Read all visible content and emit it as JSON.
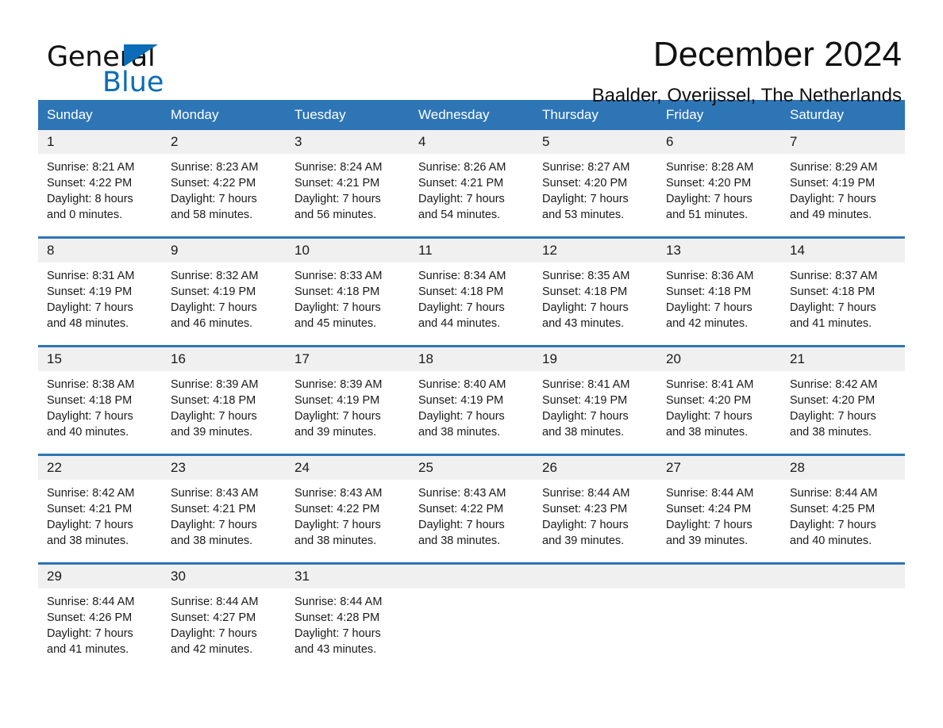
{
  "brand": {
    "name_part1": "General",
    "name_part2": "Blue"
  },
  "header": {
    "title": "December 2024",
    "location": "Baalder, Overijssel, The Netherlands"
  },
  "colors": {
    "header_blue": "#2e75b6",
    "logo_blue": "#0b6cb7",
    "daynum_bg": "#f0f0f0"
  },
  "weekdays": [
    "Sunday",
    "Monday",
    "Tuesday",
    "Wednesday",
    "Thursday",
    "Friday",
    "Saturday"
  ],
  "weeks": [
    [
      {
        "day": "1",
        "sunrise": "Sunrise: 8:21 AM",
        "sunset": "Sunset: 4:22 PM",
        "daylight1": "Daylight: 8 hours",
        "daylight2": "and 0 minutes."
      },
      {
        "day": "2",
        "sunrise": "Sunrise: 8:23 AM",
        "sunset": "Sunset: 4:22 PM",
        "daylight1": "Daylight: 7 hours",
        "daylight2": "and 58 minutes."
      },
      {
        "day": "3",
        "sunrise": "Sunrise: 8:24 AM",
        "sunset": "Sunset: 4:21 PM",
        "daylight1": "Daylight: 7 hours",
        "daylight2": "and 56 minutes."
      },
      {
        "day": "4",
        "sunrise": "Sunrise: 8:26 AM",
        "sunset": "Sunset: 4:21 PM",
        "daylight1": "Daylight: 7 hours",
        "daylight2": "and 54 minutes."
      },
      {
        "day": "5",
        "sunrise": "Sunrise: 8:27 AM",
        "sunset": "Sunset: 4:20 PM",
        "daylight1": "Daylight: 7 hours",
        "daylight2": "and 53 minutes."
      },
      {
        "day": "6",
        "sunrise": "Sunrise: 8:28 AM",
        "sunset": "Sunset: 4:20 PM",
        "daylight1": "Daylight: 7 hours",
        "daylight2": "and 51 minutes."
      },
      {
        "day": "7",
        "sunrise": "Sunrise: 8:29 AM",
        "sunset": "Sunset: 4:19 PM",
        "daylight1": "Daylight: 7 hours",
        "daylight2": "and 49 minutes."
      }
    ],
    [
      {
        "day": "8",
        "sunrise": "Sunrise: 8:31 AM",
        "sunset": "Sunset: 4:19 PM",
        "daylight1": "Daylight: 7 hours",
        "daylight2": "and 48 minutes."
      },
      {
        "day": "9",
        "sunrise": "Sunrise: 8:32 AM",
        "sunset": "Sunset: 4:19 PM",
        "daylight1": "Daylight: 7 hours",
        "daylight2": "and 46 minutes."
      },
      {
        "day": "10",
        "sunrise": "Sunrise: 8:33 AM",
        "sunset": "Sunset: 4:18 PM",
        "daylight1": "Daylight: 7 hours",
        "daylight2": "and 45 minutes."
      },
      {
        "day": "11",
        "sunrise": "Sunrise: 8:34 AM",
        "sunset": "Sunset: 4:18 PM",
        "daylight1": "Daylight: 7 hours",
        "daylight2": "and 44 minutes."
      },
      {
        "day": "12",
        "sunrise": "Sunrise: 8:35 AM",
        "sunset": "Sunset: 4:18 PM",
        "daylight1": "Daylight: 7 hours",
        "daylight2": "and 43 minutes."
      },
      {
        "day": "13",
        "sunrise": "Sunrise: 8:36 AM",
        "sunset": "Sunset: 4:18 PM",
        "daylight1": "Daylight: 7 hours",
        "daylight2": "and 42 minutes."
      },
      {
        "day": "14",
        "sunrise": "Sunrise: 8:37 AM",
        "sunset": "Sunset: 4:18 PM",
        "daylight1": "Daylight: 7 hours",
        "daylight2": "and 41 minutes."
      }
    ],
    [
      {
        "day": "15",
        "sunrise": "Sunrise: 8:38 AM",
        "sunset": "Sunset: 4:18 PM",
        "daylight1": "Daylight: 7 hours",
        "daylight2": "and 40 minutes."
      },
      {
        "day": "16",
        "sunrise": "Sunrise: 8:39 AM",
        "sunset": "Sunset: 4:18 PM",
        "daylight1": "Daylight: 7 hours",
        "daylight2": "and 39 minutes."
      },
      {
        "day": "17",
        "sunrise": "Sunrise: 8:39 AM",
        "sunset": "Sunset: 4:19 PM",
        "daylight1": "Daylight: 7 hours",
        "daylight2": "and 39 minutes."
      },
      {
        "day": "18",
        "sunrise": "Sunrise: 8:40 AM",
        "sunset": "Sunset: 4:19 PM",
        "daylight1": "Daylight: 7 hours",
        "daylight2": "and 38 minutes."
      },
      {
        "day": "19",
        "sunrise": "Sunrise: 8:41 AM",
        "sunset": "Sunset: 4:19 PM",
        "daylight1": "Daylight: 7 hours",
        "daylight2": "and 38 minutes."
      },
      {
        "day": "20",
        "sunrise": "Sunrise: 8:41 AM",
        "sunset": "Sunset: 4:20 PM",
        "daylight1": "Daylight: 7 hours",
        "daylight2": "and 38 minutes."
      },
      {
        "day": "21",
        "sunrise": "Sunrise: 8:42 AM",
        "sunset": "Sunset: 4:20 PM",
        "daylight1": "Daylight: 7 hours",
        "daylight2": "and 38 minutes."
      }
    ],
    [
      {
        "day": "22",
        "sunrise": "Sunrise: 8:42 AM",
        "sunset": "Sunset: 4:21 PM",
        "daylight1": "Daylight: 7 hours",
        "daylight2": "and 38 minutes."
      },
      {
        "day": "23",
        "sunrise": "Sunrise: 8:43 AM",
        "sunset": "Sunset: 4:21 PM",
        "daylight1": "Daylight: 7 hours",
        "daylight2": "and 38 minutes."
      },
      {
        "day": "24",
        "sunrise": "Sunrise: 8:43 AM",
        "sunset": "Sunset: 4:22 PM",
        "daylight1": "Daylight: 7 hours",
        "daylight2": "and 38 minutes."
      },
      {
        "day": "25",
        "sunrise": "Sunrise: 8:43 AM",
        "sunset": "Sunset: 4:22 PM",
        "daylight1": "Daylight: 7 hours",
        "daylight2": "and 38 minutes."
      },
      {
        "day": "26",
        "sunrise": "Sunrise: 8:44 AM",
        "sunset": "Sunset: 4:23 PM",
        "daylight1": "Daylight: 7 hours",
        "daylight2": "and 39 minutes."
      },
      {
        "day": "27",
        "sunrise": "Sunrise: 8:44 AM",
        "sunset": "Sunset: 4:24 PM",
        "daylight1": "Daylight: 7 hours",
        "daylight2": "and 39 minutes."
      },
      {
        "day": "28",
        "sunrise": "Sunrise: 8:44 AM",
        "sunset": "Sunset: 4:25 PM",
        "daylight1": "Daylight: 7 hours",
        "daylight2": "and 40 minutes."
      }
    ],
    [
      {
        "day": "29",
        "sunrise": "Sunrise: 8:44 AM",
        "sunset": "Sunset: 4:26 PM",
        "daylight1": "Daylight: 7 hours",
        "daylight2": "and 41 minutes."
      },
      {
        "day": "30",
        "sunrise": "Sunrise: 8:44 AM",
        "sunset": "Sunset: 4:27 PM",
        "daylight1": "Daylight: 7 hours",
        "daylight2": "and 42 minutes."
      },
      {
        "day": "31",
        "sunrise": "Sunrise: 8:44 AM",
        "sunset": "Sunset: 4:28 PM",
        "daylight1": "Daylight: 7 hours",
        "daylight2": "and 43 minutes."
      },
      {
        "day": "",
        "sunrise": "",
        "sunset": "",
        "daylight1": "",
        "daylight2": ""
      },
      {
        "day": "",
        "sunrise": "",
        "sunset": "",
        "daylight1": "",
        "daylight2": ""
      },
      {
        "day": "",
        "sunrise": "",
        "sunset": "",
        "daylight1": "",
        "daylight2": ""
      },
      {
        "day": "",
        "sunrise": "",
        "sunset": "",
        "daylight1": "",
        "daylight2": ""
      }
    ]
  ]
}
